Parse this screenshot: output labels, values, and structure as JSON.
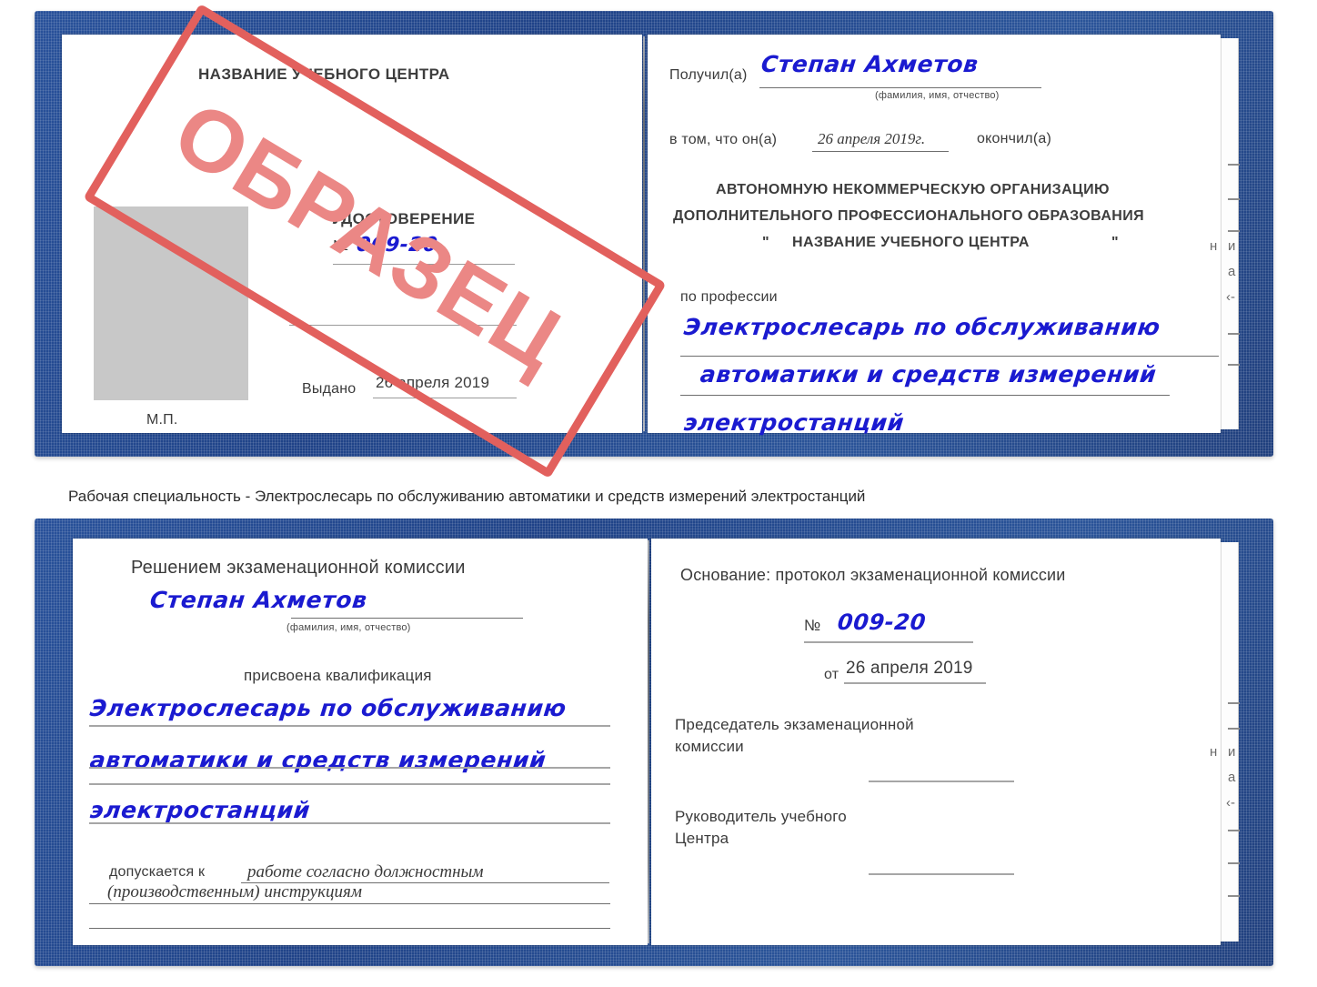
{
  "document": {
    "type": "certificate",
    "language": "ru",
    "watermark": {
      "label": "ОБРАЗЕЦ",
      "color": "#e2605d"
    }
  },
  "caption": {
    "text": "Рабочая специальность - Электрослесарь по обслуживанию автоматики и средств измерений электростанций"
  },
  "cert_top": {
    "left_page": {
      "center_name": "НАЗВАНИЕ УЧЕБНОГО ЦЕНТРА",
      "doc_title": "УДОСТОВЕРЕНИЕ",
      "number_label": "№",
      "number_value": "009-20",
      "issued_label": "Выдано",
      "issued_value": "26 апреля 2019",
      "seal_label": "М.П."
    },
    "right_page": {
      "received_label": "Получил(а)",
      "received_value": "Степан Ахметов",
      "fio_hint": "(фамилия, имя, отчество)",
      "that_label": "в том, что он(а)",
      "that_date": "26 апреля 2019г.",
      "finished_label": "окончил(а)",
      "org_line1": "АВТОНОМНУЮ НЕКОММЕРЧЕСКУЮ ОРГАНИЗАЦИЮ",
      "org_line2": "ДОПОЛНИТЕЛЬНОГО ПРОФЕССИОНАЛЬНОГО ОБРАЗОВАНИЯ",
      "org_quote_open": "\"",
      "org_line3": "НАЗВАНИЕ УЧЕБНОГО ЦЕНТРА",
      "org_quote_close": "\"",
      "profession_label": "по профессии",
      "profession_line1": "Электрослесарь по обслуживанию",
      "profession_line2": "автоматики и средств измерений",
      "profession_line3": "электростанций"
    }
  },
  "cert_bottom": {
    "left_page": {
      "commission_title": "Решением экзаменационной комиссии",
      "name_value": "Степан Ахметов",
      "fio_hint": "(фамилия, имя, отчество)",
      "qualification_label": "присвоена квалификация",
      "qualification_line1": "Электрослесарь по обслуживанию",
      "qualification_line2": "автоматики и средств измерений",
      "qualification_line3": "электростанций",
      "admitted_label": "допускается к",
      "admitted_line1": "работе согласно должностным",
      "admitted_line2": "(производственным) инструкциям"
    },
    "right_page": {
      "basis_label": "Основание: протокол экзаменационной комиссии",
      "protocol_number_label": "№",
      "protocol_number_value": "009-20",
      "protocol_date_label": "от",
      "protocol_date_value": "26 апреля 2019",
      "chairman_line1": "Председатель экзаменационной",
      "chairman_line2": "комиссии",
      "head_line1": "Руководитель учебного",
      "head_line2": "Центра"
    }
  },
  "page_edge_fragments": {
    "top": [
      "–",
      "–",
      "–",
      "и",
      "а",
      "‹-",
      "–",
      "–",
      "–"
    ],
    "bottom": [
      "–",
      "–",
      "и",
      "а",
      "‹-",
      "–",
      "–",
      "–"
    ]
  }
}
